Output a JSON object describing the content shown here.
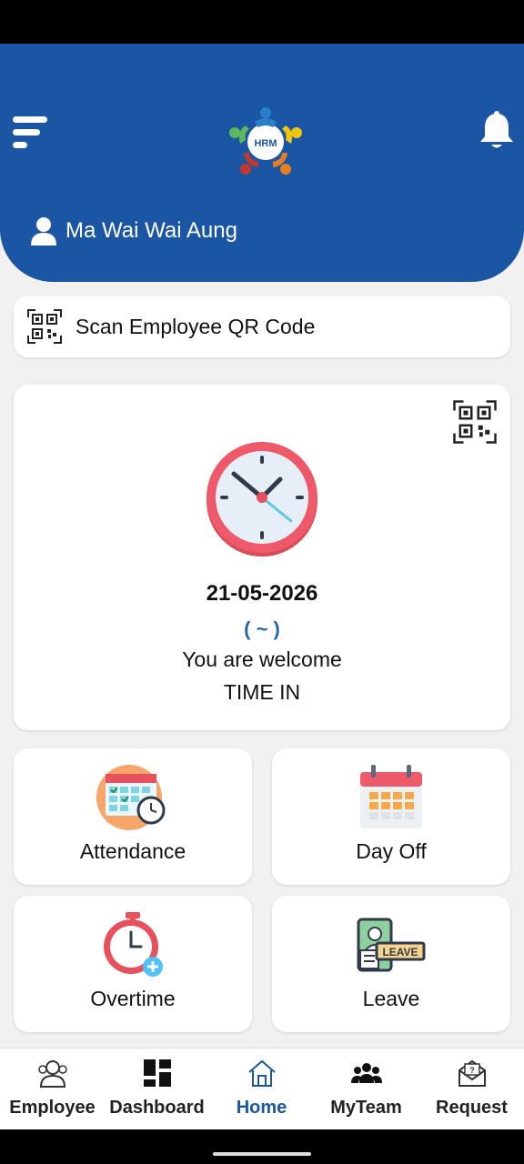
{
  "header": {
    "user_name": "Ma Wai Wai Aung",
    "logo_text": "HRM",
    "icons": {
      "menu": "menu-icon",
      "notification": "bell-icon",
      "user": "user-icon"
    }
  },
  "scan": {
    "label": "Scan Employee QR Code",
    "icon": "qr-code-icon"
  },
  "attendance_card": {
    "date": "21-05-2026",
    "status": "( ~ )",
    "message": "You are welcome",
    "action": "TIME IN"
  },
  "tiles": [
    {
      "label": "Attendance",
      "icon": "attendance-calendar-icon"
    },
    {
      "label": "Day Off",
      "icon": "day-off-calendar-icon"
    },
    {
      "label": "Overtime",
      "icon": "overtime-stopwatch-icon"
    },
    {
      "label": "Leave",
      "icon": "leave-badge-icon"
    }
  ],
  "bottom_nav": [
    {
      "label": "Employee",
      "icon": "employee-icon"
    },
    {
      "label": "Dashboard",
      "icon": "dashboard-icon"
    },
    {
      "label": "Home",
      "icon": "home-icon",
      "active": true
    },
    {
      "label": "MyTeam",
      "icon": "team-icon"
    },
    {
      "label": "Request",
      "icon": "request-mail-icon"
    }
  ],
  "colors": {
    "primary": "#1b56a5",
    "background": "#f1f1f1",
    "card": "#ffffff",
    "accent_red": "#e8505b"
  }
}
